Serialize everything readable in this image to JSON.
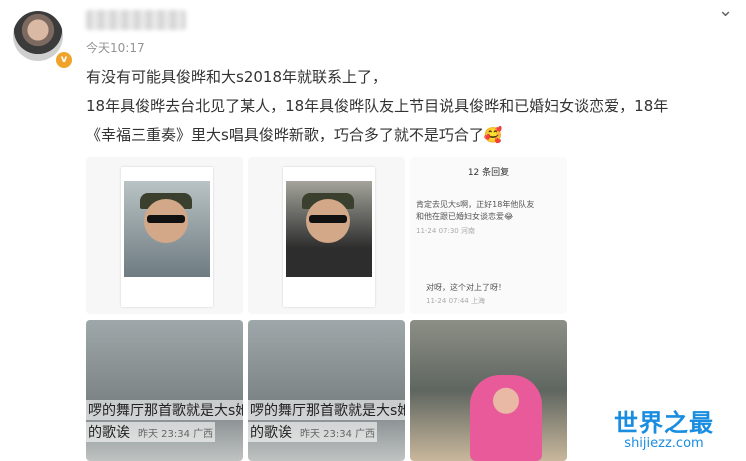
{
  "post": {
    "time": "今天10:17",
    "verified_badge": "v",
    "more_chevron": "⌄",
    "lines": [
      "有没有可能具俊晔和大s2018年就联系上了，",
      "18年具俊晔去台北见了某人，18年具俊晔队友上节目说具俊晔和已婚妇女谈恋爱，18年",
      "《幸福三重奏》里大s唱具俊晔新歌，巧合多了就不是巧合了🥰"
    ]
  },
  "images": {
    "comments": {
      "header": "12 条回复",
      "c1": "肯定去见大s啊，正好18年他队友",
      "c1b": "和他在跟已婚妇女谈恋爱😂",
      "c1meta": "11-24 07:30 河南",
      "c2": "对呀，这个对上了呀！",
      "c2meta": "11-24 07:44 上海"
    },
    "caption1": "啰的舞厅那首歌就是大s她",
    "caption2": "的歌诶",
    "caption_meta": "昨天 23:34 广西"
  },
  "watermark": {
    "top": "世界之最",
    "bottom": "shijiezz.com"
  }
}
